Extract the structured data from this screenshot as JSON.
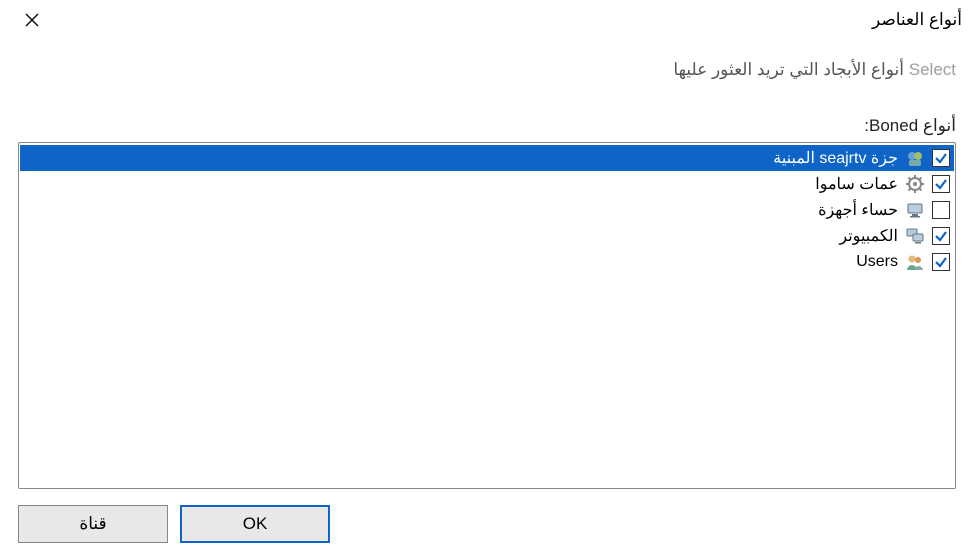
{
  "title": "أنواع العناصر",
  "desc_dim": "Select",
  "desc_rest": " أنواع الأبجاد التي تريد العثور عليها",
  "list_label": "أنواع Boned:",
  "items": [
    {
      "label": "جزة seajrtv المبنية",
      "checked": true,
      "selected": true,
      "icon": "security-icon"
    },
    {
      "label": "عمات ساموا",
      "checked": true,
      "selected": false,
      "icon": "gear-icon",
      "highlight": true
    },
    {
      "label": "حساء أجهزة",
      "checked": false,
      "selected": false,
      "icon": "computer-icon"
    },
    {
      "label": "الكمبيوتر",
      "checked": true,
      "selected": false,
      "icon": "computers-icon"
    },
    {
      "label": "Users",
      "checked": true,
      "selected": false,
      "icon": "users-icon"
    }
  ],
  "ok": "OK",
  "cancel": "قناة"
}
